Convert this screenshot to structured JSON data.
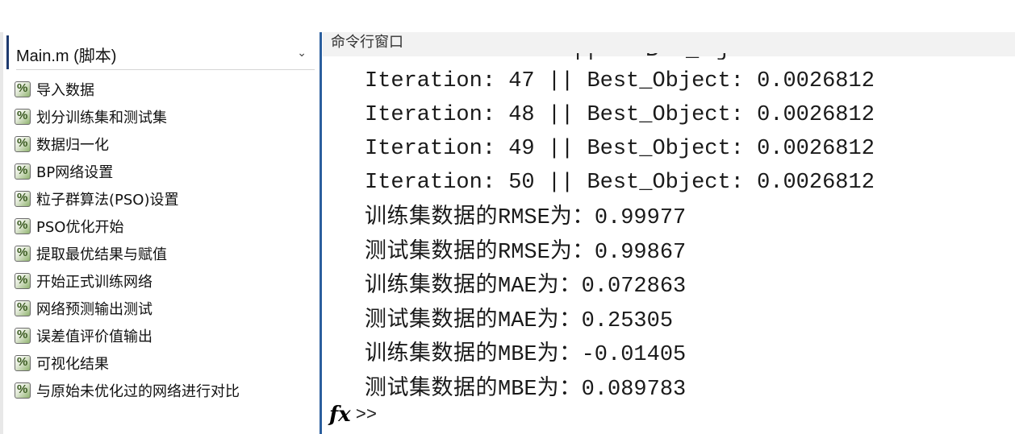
{
  "left_panel": {
    "file_select": "Main.m  (脚本)",
    "sections": [
      "导入数据",
      "划分训练集和测试集",
      "数据归一化",
      "BP网络设置",
      "粒子群算法(PSO)设置",
      "PSO优化开始",
      "提取最优结果与赋值",
      "开始正式训练网络",
      "网络预测输出测试",
      "误差值评价值输出",
      "可视化结果",
      "与原始未优化过的网络进行对比"
    ]
  },
  "command_window": {
    "title": "命令行窗口",
    "iterations": [
      "Iteration: 47 || Best_Object: 0.0026812",
      "Iteration: 48 || Best_Object: 0.0026812",
      "Iteration: 49 || Best_Object: 0.0026812",
      "Iteration: 50 || Best_Object: 0.0026812"
    ],
    "metrics": [
      {
        "label": "训练集数据的",
        "name": "RMSE",
        "suffix": "为：",
        "value": "0.99977"
      },
      {
        "label": "测试集数据的",
        "name": "RMSE",
        "suffix": "为：",
        "value": "0.99867"
      },
      {
        "label": "训练集数据的",
        "name": "MAE",
        "suffix": "为：",
        "value": "0.072863"
      },
      {
        "label": "测试集数据的",
        "name": "MAE",
        "suffix": "为：",
        "value": "0.25305"
      },
      {
        "label": "训练集数据的",
        "name": "MBE",
        "suffix": "为：",
        "value": "-0.01405"
      },
      {
        "label": "测试集数据的",
        "name": "MBE",
        "suffix": "为：",
        "value": "0.089783"
      }
    ],
    "fx_symbol": "fx",
    "prompt": ">>"
  }
}
